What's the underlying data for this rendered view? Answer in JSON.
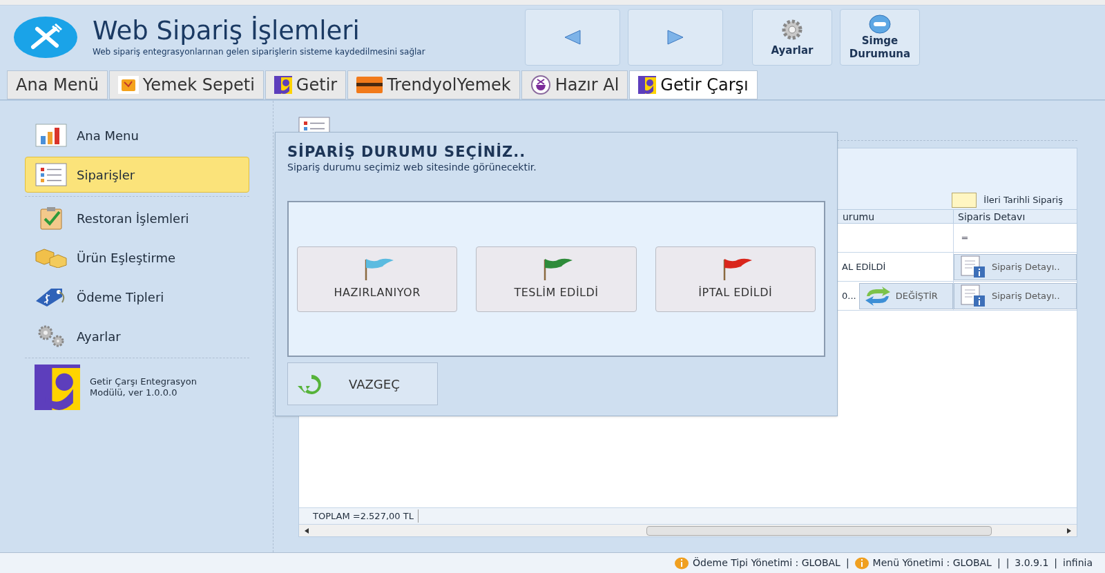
{
  "header": {
    "title": "Web Sipariş İşlemleri",
    "subtitle": "Web sipariş entegrasyonlarınan gelen siparişlerin sisteme kaydedilmesini sağlar",
    "buttons": [
      {
        "kind": "back"
      },
      {
        "kind": "forward"
      },
      {
        "kind": "settings",
        "label": "Ayarlar"
      },
      {
        "kind": "minimize",
        "label": "Simge Durumuna"
      }
    ]
  },
  "tabs": [
    {
      "label": "Ana Menü",
      "kind": "plain",
      "selected": false
    },
    {
      "label": "Yemek Sepeti",
      "kind": "box",
      "selected": false
    },
    {
      "label": "Getir",
      "kind": "g",
      "selected": false
    },
    {
      "label": "TrendyolYemek",
      "kind": "bar",
      "selected": false
    },
    {
      "label": "Hazır Al",
      "kind": "circle",
      "selected": false
    },
    {
      "label": "Getir Çarşı",
      "kind": "g",
      "selected": true
    }
  ],
  "sidebar": {
    "items": [
      {
        "label": "Ana Menu",
        "kind": "chart",
        "selected": false
      },
      {
        "label": "Siparişler",
        "kind": "list",
        "selected": true
      },
      {
        "label": "Restoran İşlemleri",
        "kind": "clipboard",
        "selected": false
      },
      {
        "label": "Ürün Eşleştirme",
        "kind": "boxes",
        "selected": false
      },
      {
        "label": "Ödeme Tipleri",
        "kind": "tag",
        "selected": false
      },
      {
        "label": "Ayarlar",
        "kind": "gears",
        "selected": false
      }
    ],
    "module": [
      "Getir Çarşı Entegrasyon",
      "Modülü, ver 1.0.0.0"
    ]
  },
  "content": {
    "legend": "İleri Tarihli Sipariş",
    "columns": [
      "urumu",
      "Siparis Detavı"
    ],
    "rows": [
      {
        "status": "",
        "detail": {
          "kind": "text",
          "label": "═"
        }
      },
      {
        "status": "AL EDİLDİ",
        "detail": {
          "kind": "button",
          "label": "Sipariş Detayı.."
        }
      },
      {
        "status": "0...",
        "action": "DEĞİŞTİR",
        "detail": {
          "kind": "button",
          "label": "Sipariş Detayı.."
        }
      }
    ],
    "total": "TOPLAM =2.527,00 TL"
  },
  "dialog": {
    "title": "SİPARİŞ DURUMU SEÇİNİZ..",
    "subtitle": "Sipariş durumu seçimiz web sitesinde görünecektir.",
    "options": [
      {
        "label": "HAZIRLANIYOR",
        "color": "#5bbbe0"
      },
      {
        "label": "TESLİM EDİLDİ",
        "color": "#2e8b3a"
      },
      {
        "label": "İPTAL EDİLDİ",
        "color": "#d9261c"
      }
    ],
    "cancel": "VAZGEÇ"
  },
  "status_bar": [
    {
      "kind": "info",
      "text": "Ödeme Tipi Yönetimi : GLOBAL"
    },
    {
      "kind": "sep",
      "text": "|"
    },
    {
      "kind": "info",
      "text": "Menü Yönetimi : GLOBAL"
    },
    {
      "kind": "sep",
      "text": "|"
    },
    {
      "kind": "sep",
      "text": "|"
    },
    {
      "kind": "text",
      "text": "3.0.9.1"
    },
    {
      "kind": "sep",
      "text": "|"
    },
    {
      "kind": "text",
      "text": "infinia"
    }
  ]
}
